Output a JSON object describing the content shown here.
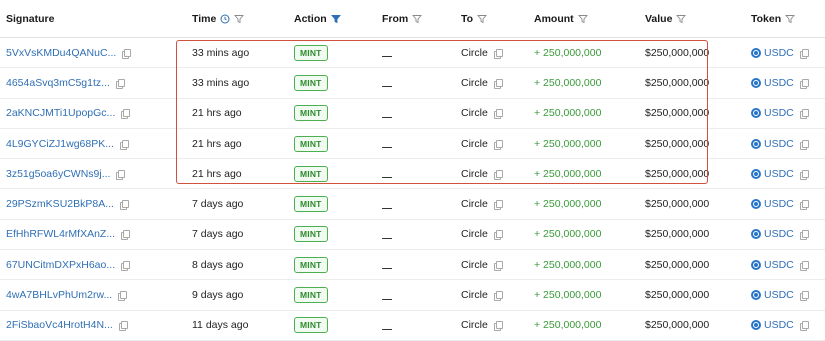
{
  "headers": {
    "signature": "Signature",
    "time": "Time",
    "action": "Action",
    "from": "From",
    "to": "To",
    "amount": "Amount",
    "value": "Value",
    "token": "Token"
  },
  "colors": {
    "link": "#2f6fb5",
    "amount_green": "#3a9a3a",
    "badge_green": "#4caf50",
    "highlight_red": "#d1513d",
    "active_filter": "#2f6fb5"
  },
  "rows": [
    {
      "signature": "5VxVsKMDu4QANuC...",
      "time": "33 mins ago",
      "action": "MINT",
      "from": "",
      "to": "Circle",
      "amount": "+ 250,000,000",
      "value": "$250,000,000",
      "token": "USDC"
    },
    {
      "signature": "4654aSvq3mC5g1tz...",
      "time": "33 mins ago",
      "action": "MINT",
      "from": "",
      "to": "Circle",
      "amount": "+ 250,000,000",
      "value": "$250,000,000",
      "token": "USDC"
    },
    {
      "signature": "2aKNCJMTi1UpopGc...",
      "time": "21 hrs ago",
      "action": "MINT",
      "from": "",
      "to": "Circle",
      "amount": "+ 250,000,000",
      "value": "$250,000,000",
      "token": "USDC"
    },
    {
      "signature": "4L9GYCiZJ1wg68PK...",
      "time": "21 hrs ago",
      "action": "MINT",
      "from": "",
      "to": "Circle",
      "amount": "+ 250,000,000",
      "value": "$250,000,000",
      "token": "USDC"
    },
    {
      "signature": "3z51g5oa6yCWNs9j...",
      "time": "21 hrs ago",
      "action": "MINT",
      "from": "",
      "to": "Circle",
      "amount": "+ 250,000,000",
      "value": "$250,000,000",
      "token": "USDC"
    },
    {
      "signature": "29PSzmKSU2BkP8A...",
      "time": "7 days ago",
      "action": "MINT",
      "from": "",
      "to": "Circle",
      "amount": "+ 250,000,000",
      "value": "$250,000,000",
      "token": "USDC"
    },
    {
      "signature": "EfHhRFWL4rMfXAnZ...",
      "time": "7 days ago",
      "action": "MINT",
      "from": "",
      "to": "Circle",
      "amount": "+ 250,000,000",
      "value": "$250,000,000",
      "token": "USDC"
    },
    {
      "signature": "67UNCitmDXPxH6ao...",
      "time": "8 days ago",
      "action": "MINT",
      "from": "",
      "to": "Circle",
      "amount": "+ 250,000,000",
      "value": "$250,000,000",
      "token": "USDC"
    },
    {
      "signature": "4wA7BHLvPhUm2rw...",
      "time": "9 days ago",
      "action": "MINT",
      "from": "",
      "to": "Circle",
      "amount": "+ 250,000,000",
      "value": "$250,000,000",
      "token": "USDC"
    },
    {
      "signature": "2FiSbaoVc4HrotH4N...",
      "time": "11 days ago",
      "action": "MINT",
      "from": "",
      "to": "Circle",
      "amount": "+ 250,000,000",
      "value": "$250,000,000",
      "token": "USDC"
    }
  ]
}
